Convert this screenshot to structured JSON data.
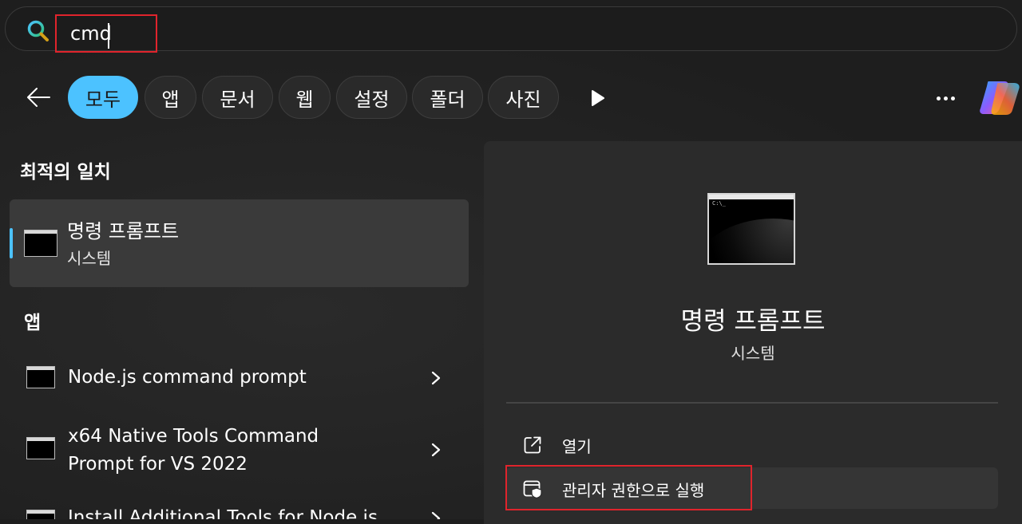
{
  "search": {
    "value": "cmd"
  },
  "filters": [
    {
      "label": "모두",
      "active": true
    },
    {
      "label": "앱"
    },
    {
      "label": "문서"
    },
    {
      "label": "웹"
    },
    {
      "label": "설정"
    },
    {
      "label": "폴더"
    },
    {
      "label": "사진"
    }
  ],
  "best_match": {
    "section_title": "최적의 일치",
    "title": "명령 프롬프트",
    "subtitle": "시스템"
  },
  "apps": {
    "section_title": "앱",
    "items": [
      {
        "label": "Node.js command prompt"
      },
      {
        "label_line1": "x64 Native Tools Command",
        "label_line2": "Prompt for VS 2022"
      },
      {
        "label": "Install Additional Tools for Node.js"
      }
    ]
  },
  "details": {
    "title": "명령 프롬프트",
    "subtitle": "시스템",
    "thumb_prompt": "C:\\_",
    "actions": [
      {
        "label": "열기",
        "icon": "open-external-icon"
      },
      {
        "label": "관리자 권한으로 실행",
        "icon": "shield-admin-icon"
      }
    ]
  },
  "colors": {
    "accent": "#4cc2ff",
    "annotation_red": "#e0242c"
  }
}
